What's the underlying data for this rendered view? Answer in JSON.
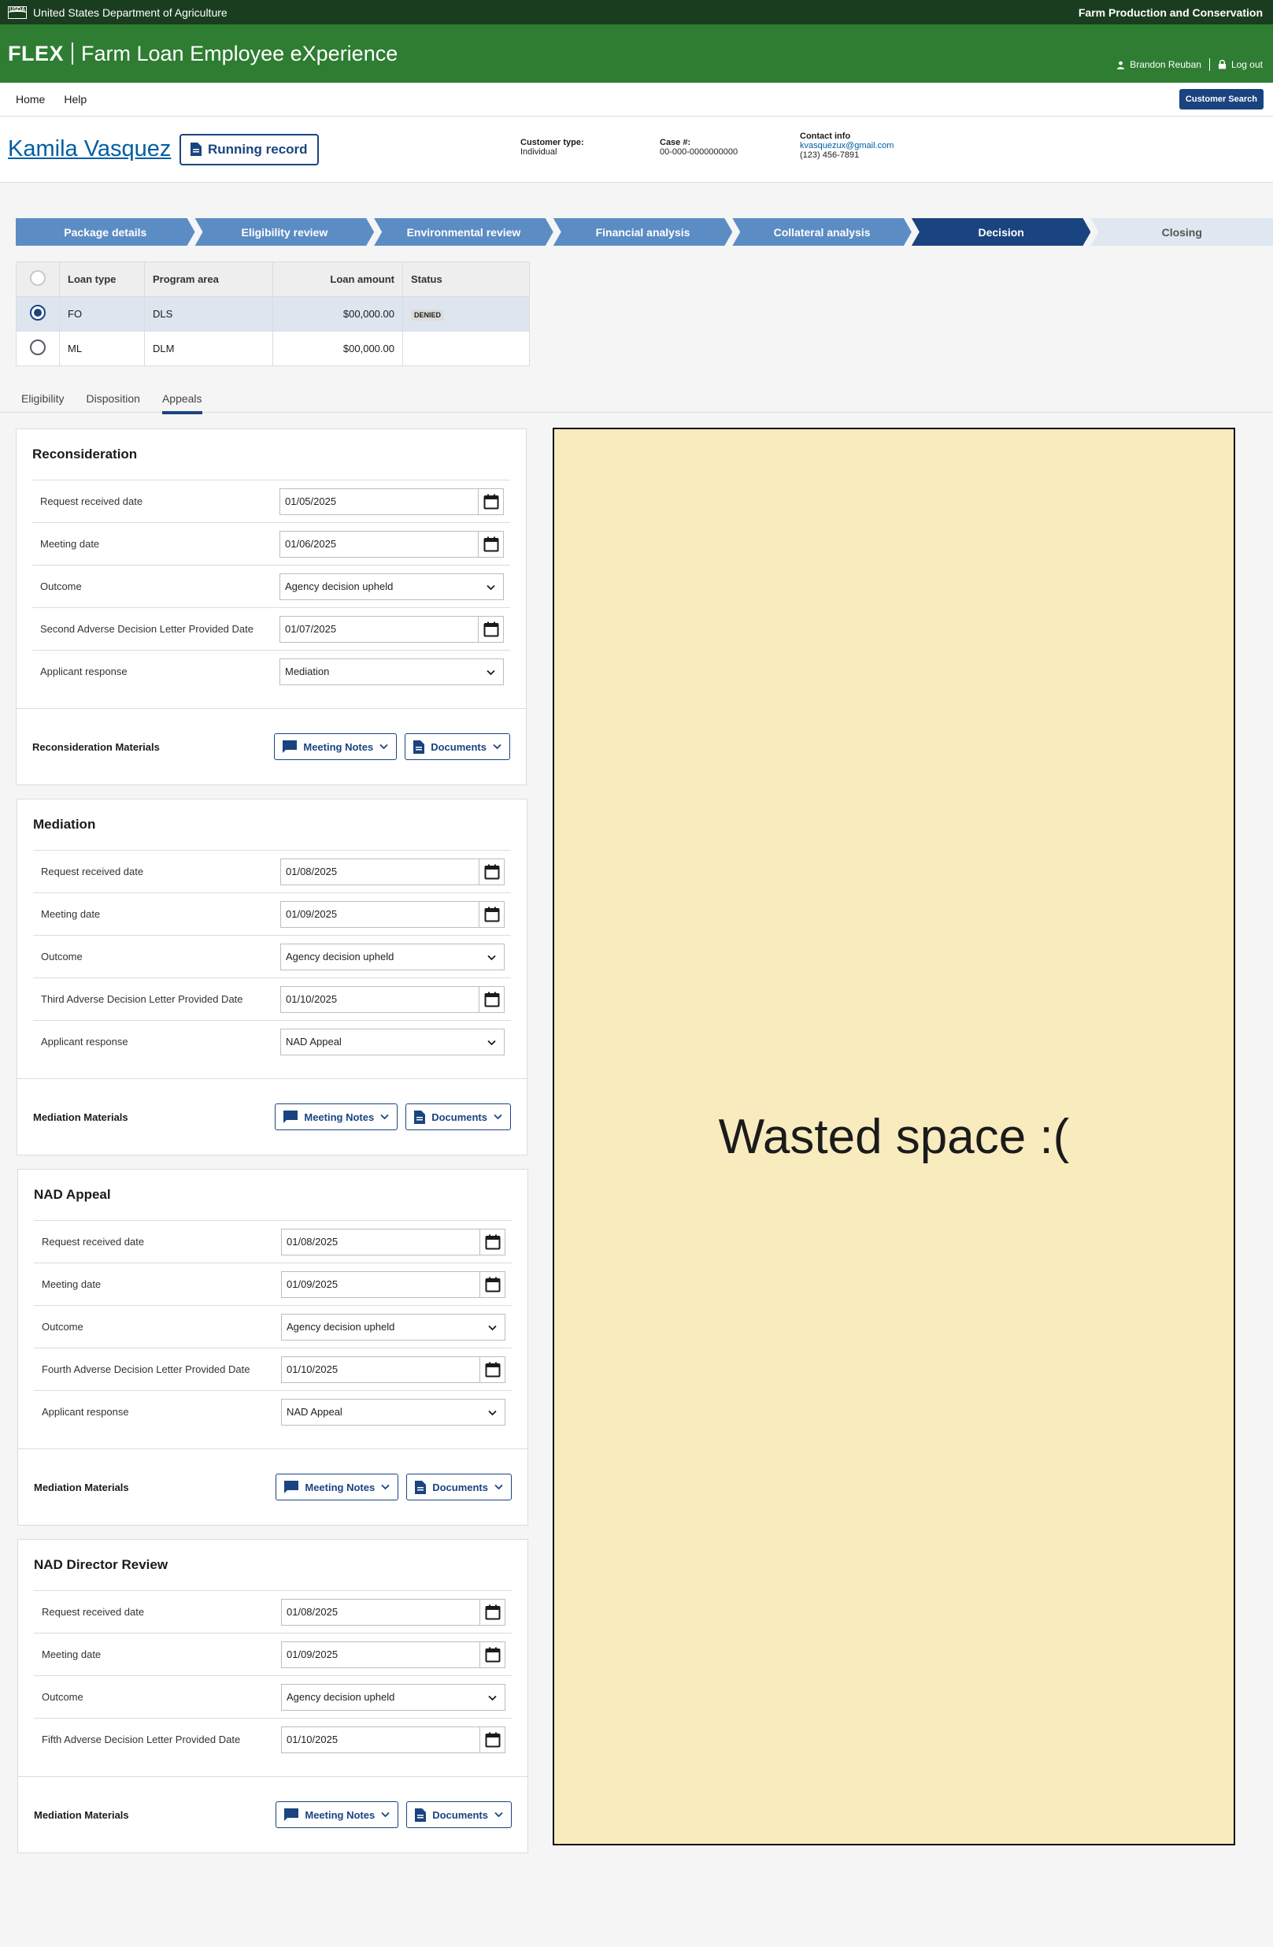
{
  "banner": {
    "agency": "United States Department of Agriculture",
    "mission_area": "Farm Production and Conservation",
    "logo_text": "USDA"
  },
  "header": {
    "product": "FLEX",
    "app_name": "Farm Loan Employee eXperience",
    "user": "Brandon Reuban",
    "logout": "Log out"
  },
  "nav": {
    "home": "Home",
    "help": "Help",
    "customer_search": "Customer Search"
  },
  "customer": {
    "name": "Kamila Vasquez",
    "running_record": "Running record",
    "type_label": "Customer type:",
    "type_value": "Individual",
    "case_label": "Case #:",
    "case_value": "00-000-0000000000",
    "contact_label": "Contact info",
    "email": "kvasquezux@gmail.com",
    "phone": "(123) 456-7891"
  },
  "steps": [
    {
      "label": "Package details",
      "state": "done"
    },
    {
      "label": "Eligibility review",
      "state": "done"
    },
    {
      "label": "Environmental review",
      "state": "done"
    },
    {
      "label": "Financial analysis",
      "state": "done"
    },
    {
      "label": "Collateral analysis",
      "state": "done"
    },
    {
      "label": "Decision",
      "state": "current"
    },
    {
      "label": "Closing",
      "state": "todo"
    }
  ],
  "loans": {
    "headers": [
      "Loan type",
      "Program area",
      "Loan amount",
      "Status"
    ],
    "rows": [
      {
        "type": "FO",
        "program": "DLS",
        "amount": "$00,000.00",
        "status": "DENIED"
      },
      {
        "type": "ML",
        "program": "DLM",
        "amount": "$00,000.00",
        "status": ""
      }
    ]
  },
  "tabs": [
    "Eligibility",
    "Disposition",
    "Appeals"
  ],
  "common": {
    "meeting_notes": "Meeting Notes",
    "documents": "Documents"
  },
  "cards": [
    {
      "title": "Reconsideration",
      "rows": [
        {
          "label": "Request received date",
          "value": "01/05/2025"
        },
        {
          "label": "Meeting date",
          "value": "01/06/2025"
        },
        {
          "label": "Outcome",
          "value": "Agency decision upheld"
        },
        {
          "label": "Second Adverse Decision Letter Provided Date",
          "value": "01/07/2025"
        },
        {
          "label": "Applicant response",
          "value": "Mediation"
        }
      ],
      "materials": "Reconsideration Materials"
    },
    {
      "title": "Mediation",
      "rows": [
        {
          "label": "Request received date",
          "value": "01/08/2025"
        },
        {
          "label": "Meeting date",
          "value": "01/09/2025"
        },
        {
          "label": "Outcome",
          "value": "Agency decision upheld"
        },
        {
          "label": "Third Adverse Decision Letter Provided Date",
          "value": "01/10/2025"
        },
        {
          "label": "Applicant response",
          "value": "NAD Appeal"
        }
      ],
      "materials": "Mediation Materials"
    },
    {
      "title": "NAD Appeal",
      "rows": [
        {
          "label": "Request received date",
          "value": "01/08/2025"
        },
        {
          "label": "Meeting date",
          "value": "01/09/2025"
        },
        {
          "label": "Outcome",
          "value": "Agency decision upheld"
        },
        {
          "label": "Fourth Adverse Decision Letter Provided Date",
          "value": "01/10/2025"
        },
        {
          "label": "Applicant response",
          "value": "NAD Appeal"
        }
      ],
      "materials": "Mediation Materials"
    },
    {
      "title": "NAD Director Review",
      "rows": [
        {
          "label": "Request received date",
          "value": "01/08/2025"
        },
        {
          "label": "Meeting date",
          "value": "01/09/2025"
        },
        {
          "label": "Outcome",
          "value": "Agency decision upheld"
        },
        {
          "label": "Fifth Adverse Decision Letter Provided Date",
          "value": "01/10/2025"
        }
      ],
      "materials": "Mediation Materials"
    }
  ],
  "annotation": "Wasted space :("
}
